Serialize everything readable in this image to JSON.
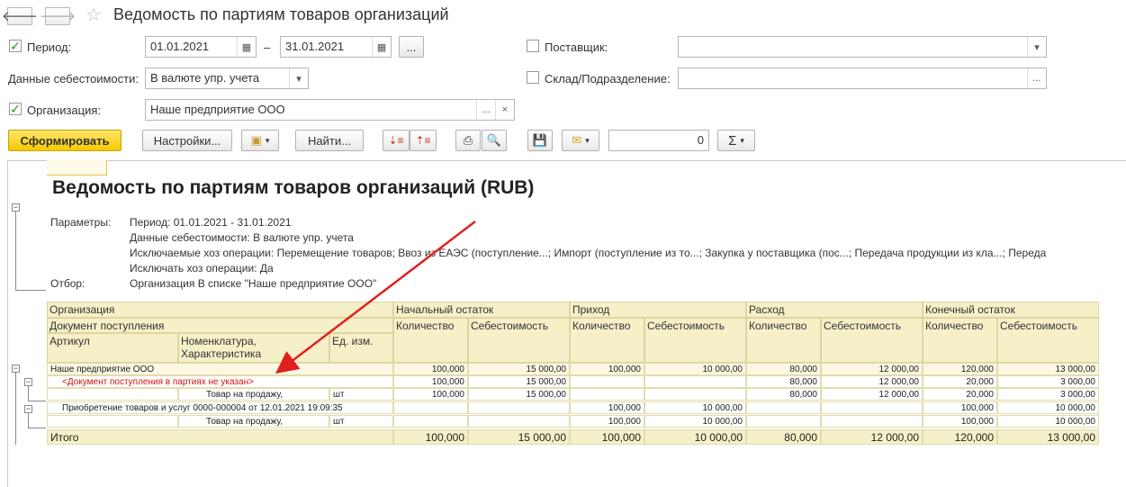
{
  "window": {
    "title": "Ведомость по партиям товаров организаций",
    "back_icon": "arrow-left-icon",
    "forward_icon": "arrow-right-icon",
    "favorite_icon": "star-icon"
  },
  "filters": {
    "period_label": "Период:",
    "period_checked": true,
    "period_from": "01.01.2021",
    "period_dash": "–",
    "period_to": "31.01.2021",
    "period_more": "...",
    "cost_label": "Данные себестоимости:",
    "cost_value": "В валюте упр. учета",
    "org_label": "Организация:",
    "org_checked": true,
    "org_value": "Наше предприятие ООО",
    "org_more": "...",
    "org_clear": "×",
    "supplier_label": "Поставщик:",
    "supplier_checked": false,
    "supplier_value": "",
    "warehouse_label": "Склад/Подразделение:",
    "warehouse_checked": false,
    "warehouse_value": "",
    "warehouse_more": "..."
  },
  "toolbar": {
    "generate_label": "Сформировать",
    "settings_label": "Настройки...",
    "find_label": "Найти...",
    "sum_value": "0",
    "sigma": "Σ"
  },
  "report": {
    "title": "Ведомость по партиям товаров организаций (RUB)",
    "params_label": "Параметры:",
    "params_lines": [
      "Период: 01.01.2021 - 31.01.2021",
      "Данные себестоимости: В валюте упр. учета",
      "Исключаемые хоз операции: Перемещение товаров; Ввоз из ЕАЭС (поступление...; Импорт (поступление из то...; Закупка у поставщика (пос...; Передача продукции из кла...; Переда",
      "Исключать хоз операции: Да"
    ],
    "filter_label": "Отбор:",
    "filter_value": "Организация В списке \"Наше предприятие ООО\"",
    "headers": {
      "org": "Организация",
      "doc": "Документ поступления",
      "article": "Артикул",
      "nomenclature": "Номенклатура, Характеристика",
      "unit": "Ед. изм.",
      "opening": "Начальный остаток",
      "income": "Приход",
      "expense": "Расход",
      "closing": "Конечный остаток",
      "qty": "Количество",
      "cost": "Себестоимость"
    },
    "rows": [
      {
        "name": "Наше предприятие ООО",
        "unit": "",
        "v": [
          "100,000",
          "15 000,00",
          "100,000",
          "10 000,00",
          "80,000",
          "12 000,00",
          "120,000",
          "13 000,00"
        ]
      },
      {
        "name": "<Документ поступления в партиях не указан>",
        "unit": "",
        "v": [
          "100,000",
          "15 000,00",
          "",
          "",
          "80,000",
          "12 000,00",
          "20,000",
          "3 000,00"
        ]
      },
      {
        "name": "Товар на продажу,",
        "unit": "шт",
        "v": [
          "100,000",
          "15 000,00",
          "",
          "",
          "80,000",
          "12 000,00",
          "20,000",
          "3 000,00"
        ]
      },
      {
        "name": "Приобретение товаров и услуг 0000-000004 от 12.01.2021 19:09:35",
        "unit": "",
        "v": [
          "",
          "",
          "100,000",
          "10 000,00",
          "",
          "",
          "100,000",
          "10 000,00"
        ]
      },
      {
        "name": "Товар на продажу,",
        "unit": "шт",
        "v": [
          "",
          "",
          "100,000",
          "10 000,00",
          "",
          "",
          "100,000",
          "10 000,00"
        ]
      }
    ],
    "total": {
      "label": "Итого",
      "v": [
        "100,000",
        "15 000,00",
        "100,000",
        "10 000,00",
        "80,000",
        "12 000,00",
        "120,000",
        "13 000,00"
      ]
    }
  }
}
